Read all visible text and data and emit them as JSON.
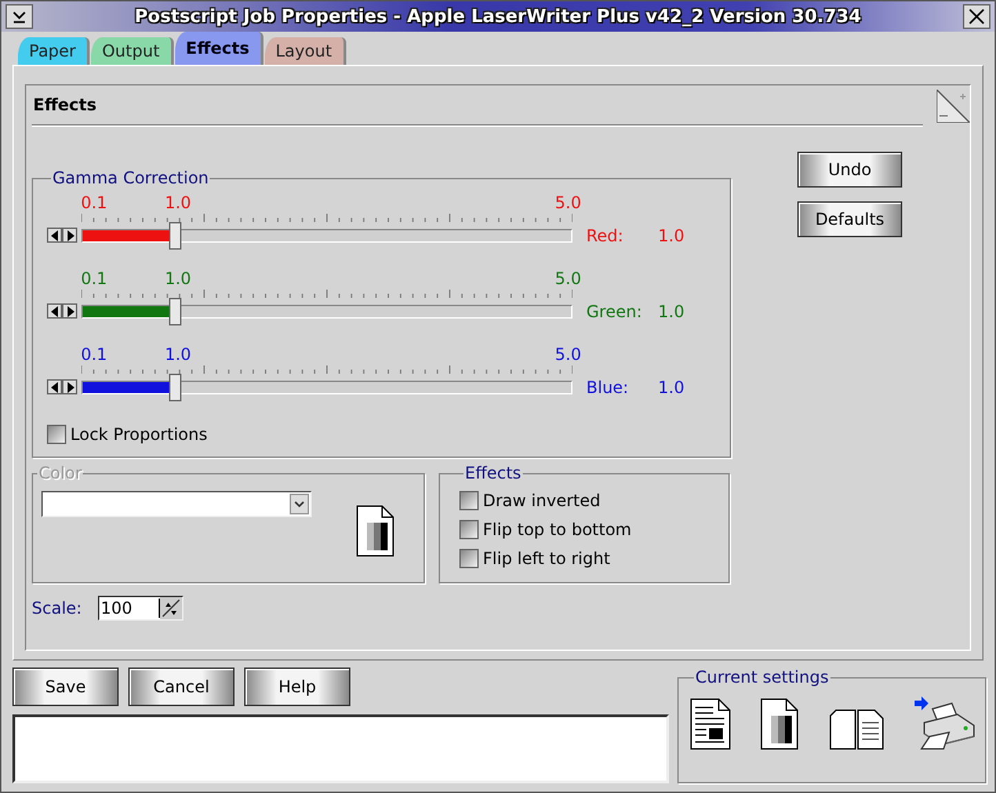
{
  "window": {
    "title": "Postscript Job Properties - Apple LaserWriter Plus v42_2 Version 30.734"
  },
  "tabs": [
    {
      "label": "Paper",
      "selected": false,
      "color": "#44ccee"
    },
    {
      "label": "Output",
      "selected": false,
      "color": "#88d8a8"
    },
    {
      "label": "Effects",
      "selected": true,
      "color": "#8898ee"
    },
    {
      "label": "Layout",
      "selected": false,
      "color": "#d4b0a8"
    }
  ],
  "panel": {
    "title": "Effects"
  },
  "gamma": {
    "title": "Gamma Correction",
    "channels": [
      {
        "min": "0.1",
        "mid": "1.0",
        "max": "5.0",
        "name": "Red:",
        "value": "1.0",
        "level": 0.19,
        "color": "#ee1111"
      },
      {
        "min": "0.1",
        "mid": "1.0",
        "max": "5.0",
        "name": "Green:",
        "value": "1.0",
        "level": 0.19,
        "color": "#117711"
      },
      {
        "min": "0.1",
        "mid": "1.0",
        "max": "5.0",
        "name": "Blue:",
        "value": "1.0",
        "level": 0.19,
        "color": "#1111dd"
      }
    ],
    "lock": {
      "label": "Lock Proportions",
      "checked": false
    }
  },
  "color_group": {
    "title": "Color",
    "disabled": true
  },
  "effects_group": {
    "title": "Effects",
    "options": [
      {
        "label": "Draw inverted",
        "checked": false
      },
      {
        "label": "Flip top to bottom",
        "checked": false
      },
      {
        "label": "Flip left to right",
        "checked": false
      }
    ]
  },
  "scale": {
    "label": "Scale:",
    "value": "100"
  },
  "side_buttons": [
    "Undo",
    "Defaults"
  ],
  "buttons": [
    "Save",
    "Cancel",
    "Help"
  ],
  "current_settings": {
    "title": "Current settings"
  }
}
